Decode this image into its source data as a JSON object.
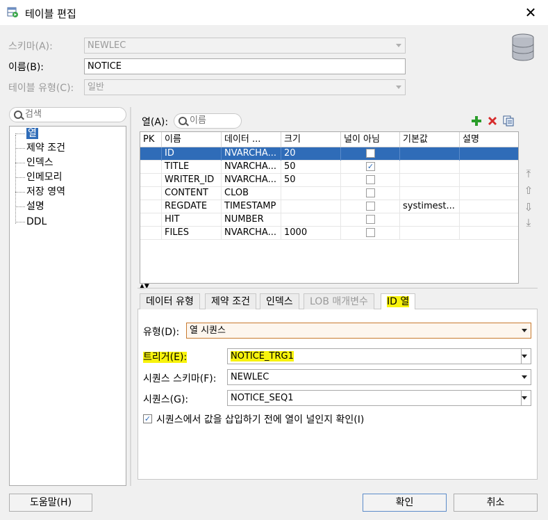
{
  "window": {
    "title": "테이블 편집"
  },
  "form": {
    "schema_label": "스키마(A):",
    "schema_value": "NEWLEC",
    "name_label": "이름(B):",
    "name_value": "NOTICE",
    "table_type_label": "테이블 유형(C):",
    "table_type_value": "일반"
  },
  "left": {
    "search_placeholder": "검색",
    "tree": [
      "열",
      "제약 조건",
      "인덱스",
      "인메모리",
      "저장 영역",
      "설명",
      "DDL"
    ],
    "selected": 0
  },
  "columns_panel": {
    "label": "열(A):",
    "search_placeholder": "이름",
    "headers": [
      "PK",
      "이름",
      "데이터 ...",
      "크기",
      "널이 아님",
      "기본값",
      "설명"
    ],
    "rows": [
      {
        "pk": "",
        "name": "ID",
        "type": "NVARCHA...",
        "size": "20",
        "not_null": false,
        "default": "",
        "comment": ""
      },
      {
        "pk": "",
        "name": "TITLE",
        "type": "NVARCHA...",
        "size": "50",
        "not_null": true,
        "default": "",
        "comment": ""
      },
      {
        "pk": "",
        "name": "WRITER_ID",
        "type": "NVARCHA...",
        "size": "50",
        "not_null": false,
        "default": "",
        "comment": ""
      },
      {
        "pk": "",
        "name": "CONTENT",
        "type": "CLOB",
        "size": "",
        "not_null": false,
        "default": "",
        "comment": ""
      },
      {
        "pk": "",
        "name": "REGDATE",
        "type": "TIMESTAMP",
        "size": "",
        "not_null": false,
        "default": "systimest...",
        "comment": ""
      },
      {
        "pk": "",
        "name": "HIT",
        "type": "NUMBER",
        "size": "",
        "not_null": false,
        "default": "",
        "comment": ""
      },
      {
        "pk": "",
        "name": "FILES",
        "type": "NVARCHA...",
        "size": "1000",
        "not_null": false,
        "default": "",
        "comment": ""
      }
    ],
    "selected_row": 0
  },
  "tabs": {
    "items": [
      "데이터 유형",
      "제약 조건",
      "인덱스",
      "LOB 매개변수",
      "ID 열"
    ],
    "active": 4,
    "disabled": [
      3
    ]
  },
  "id_column": {
    "type_label": "유형(D):",
    "type_value": "열 시퀀스",
    "trigger_label": "트리거(E):",
    "trigger_value": "NOTICE_TRG1",
    "seq_schema_label": "시퀀스 스키마(F):",
    "seq_schema_value": "NEWLEC",
    "sequence_label": "시퀀스(G):",
    "sequence_value": "NOTICE_SEQ1",
    "check_label": "시퀀스에서 값을 삽입하기 전에 열이 널인지 확인(I)",
    "check_checked": true
  },
  "buttons": {
    "help": "도움말(H)",
    "ok": "확인",
    "cancel": "취소"
  },
  "colors": {
    "selection": "#2f6cb8",
    "highlight": "#f8f30c"
  }
}
